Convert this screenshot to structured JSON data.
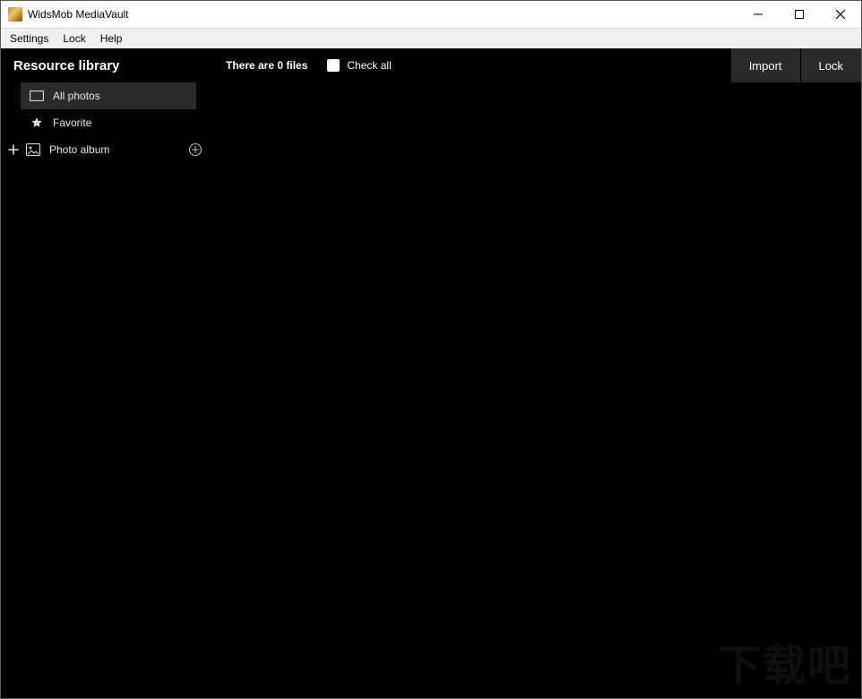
{
  "window": {
    "title": "WidsMob MediaVault"
  },
  "menubar": {
    "items": [
      {
        "label": "Settings"
      },
      {
        "label": "Lock"
      },
      {
        "label": "Help"
      }
    ]
  },
  "sidebar": {
    "title": "Resource library",
    "items": [
      {
        "id": "all-photos",
        "label": "All photos",
        "icon": "photo-rect-icon",
        "selected": true
      },
      {
        "id": "favorite",
        "label": "Favorite",
        "icon": "star-icon",
        "selected": false
      }
    ],
    "album_row": {
      "label": "Photo album",
      "icon": "picture-icon"
    }
  },
  "topbar": {
    "status": "There are 0 files",
    "check_all_label": "Check all",
    "import_label": "Import",
    "lock_label": "Lock"
  },
  "watermark": "下载吧"
}
